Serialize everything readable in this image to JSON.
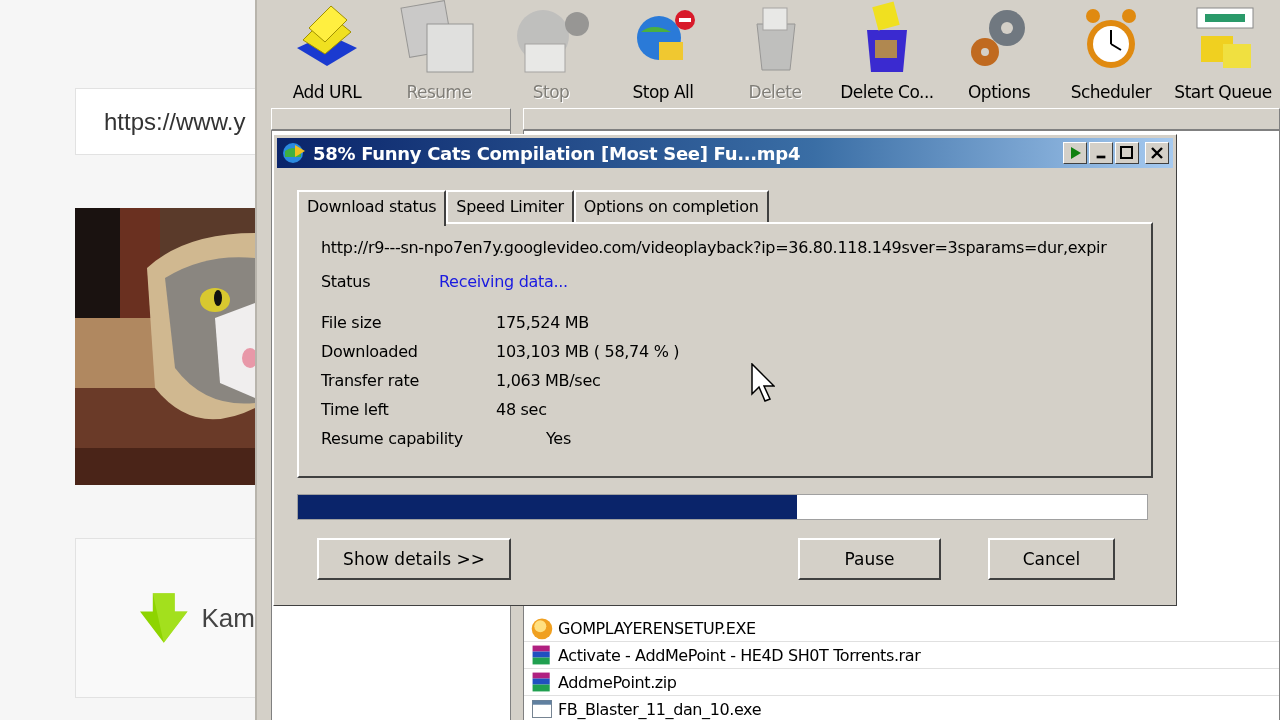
{
  "web_page": {
    "url_field": {
      "value": "https://www.y"
    },
    "download_card": {
      "label": "Kam"
    }
  },
  "toolbar": [
    {
      "label": "Add URL",
      "disabled": false
    },
    {
      "label": "Resume",
      "disabled": true
    },
    {
      "label": "Stop",
      "disabled": true
    },
    {
      "label": "Stop All",
      "disabled": false
    },
    {
      "label": "Delete",
      "disabled": true
    },
    {
      "label": "Delete Co...",
      "disabled": false
    },
    {
      "label": "Options",
      "disabled": false
    },
    {
      "label": "Scheduler",
      "disabled": false
    },
    {
      "label": "Start Queue",
      "disabled": false
    }
  ],
  "file_list": {
    "rows": [
      {
        "kind": "exe",
        "name": "GOMPLAYERENSETUP.EXE"
      },
      {
        "kind": "archive",
        "name": "Activate - AddMePoint - HE4D SH0T Torrents.rar"
      },
      {
        "kind": "archive",
        "name": "AddmePoint.zip"
      },
      {
        "kind": "app",
        "name": "FB_Blaster_11_dan_10.exe"
      }
    ]
  },
  "dialog": {
    "title": "58% Funny Cats Compilation [Most See] Fu...mp4",
    "tabs": [
      {
        "label": "Download status",
        "selected": true
      },
      {
        "label": "Speed Limiter",
        "selected": false
      },
      {
        "label": "Options on completion",
        "selected": false
      }
    ],
    "url": "http://r9---sn-npo7en7y.googlevideo.com/videoplayback?ip=36.80.118.149sver=3sparams=dur,expir",
    "status": {
      "label": "Status",
      "value": "Receiving data..."
    },
    "details": [
      {
        "label": "File size",
        "value": "175,524  MB"
      },
      {
        "label": "Downloaded",
        "value": "103,103  MB  ( 58,74 % )"
      },
      {
        "label": "Transfer rate",
        "value": "1,063  MB/sec"
      },
      {
        "label": "Time left",
        "value": "48 sec"
      }
    ],
    "resume": {
      "label": "Resume capability",
      "value": "Yes"
    },
    "progress": {
      "level": 0.5874
    },
    "buttons": [
      "Show details >>",
      "Pause",
      "Cancel"
    ]
  }
}
